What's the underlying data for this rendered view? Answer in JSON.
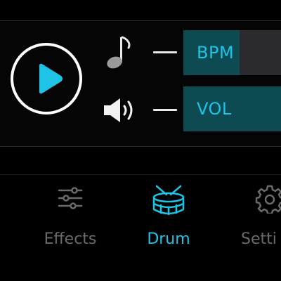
{
  "controls": {
    "play_icon": "play-icon",
    "bpm": {
      "label": "BPM",
      "icon": "music-note-icon",
      "fill": 0.53
    },
    "vol": {
      "label": "VOL",
      "icon": "speaker-icon",
      "fill": 1.0
    }
  },
  "tabs": [
    {
      "label": "Effects",
      "icon": "sliders-icon",
      "active": false
    },
    {
      "label": "Drum",
      "icon": "drum-icon",
      "active": true
    },
    {
      "label": "Setti",
      "icon": "gear-icon",
      "active": false
    }
  ],
  "colors": {
    "accent": "#1ec3e6",
    "slider_fill": "#0e4a52",
    "slider_track": "#2b2b2e",
    "inactive": "#6a6a6a",
    "background": "#000000"
  }
}
